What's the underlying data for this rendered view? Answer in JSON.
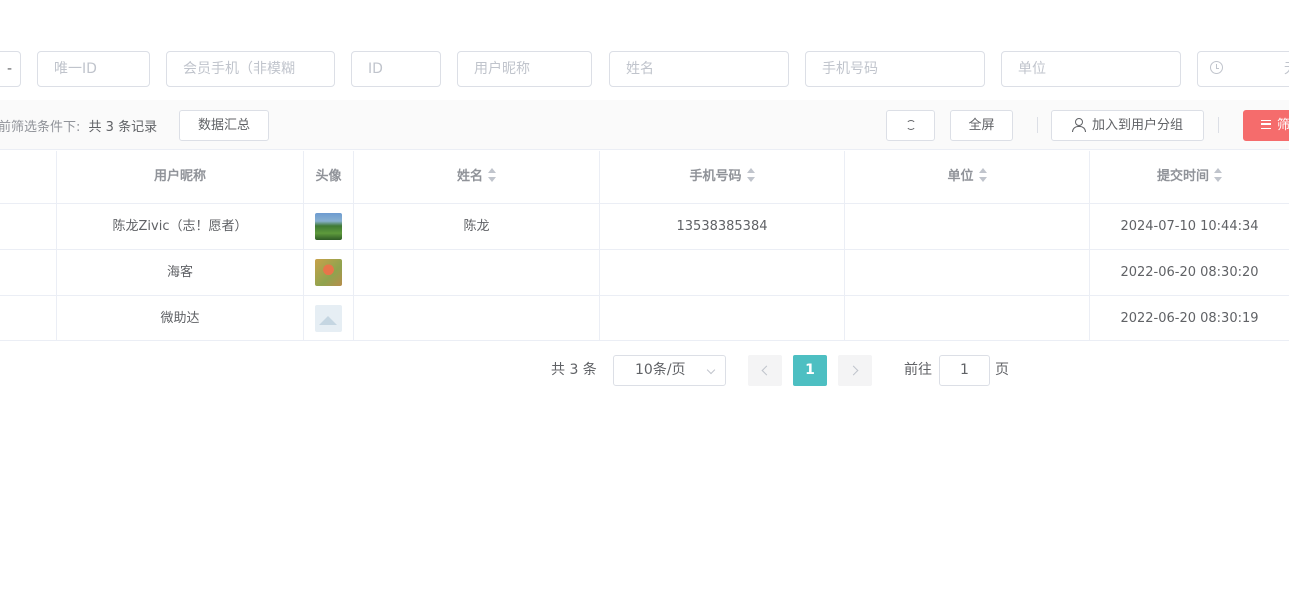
{
  "filters": {
    "stub_label": "-",
    "unique_id_placeholder": "唯一ID",
    "member_phone_placeholder": "会员手机（非模糊",
    "id_placeholder": "ID",
    "nickname_placeholder": "用户昵称",
    "name_placeholder": "姓名",
    "phone_placeholder": "手机号码",
    "unit_placeholder": "单位",
    "date_tail": "无"
  },
  "toolbar": {
    "summary_prefix": "前筛选条件下:",
    "summary_count": "共 3 条记录",
    "data_summary_label": "数据汇总",
    "fullscreen_label": "全屏",
    "add_to_group_label": "加入到用户分组",
    "filter_label": "筛"
  },
  "table": {
    "headers": {
      "nickname": "用户昵称",
      "avatar": "头像",
      "name": "姓名",
      "phone": "手机号码",
      "unit": "单位",
      "submit_time": "提交时间"
    },
    "rows": [
      {
        "nickname": "陈龙Zivic（志！愿者）",
        "avatar": "landscape",
        "name": "陈龙",
        "phone": "13538385384",
        "unit": "",
        "submit_time": "2024-07-10 10:44:34"
      },
      {
        "nickname": "海客",
        "avatar": "person",
        "name": "",
        "phone": "",
        "unit": "",
        "submit_time": "2022-06-20 08:30:20"
      },
      {
        "nickname": "微助达",
        "avatar": "placeholder",
        "name": "",
        "phone": "",
        "unit": "",
        "submit_time": "2022-06-20 08:30:19"
      }
    ]
  },
  "pagination": {
    "total": "共 3 条",
    "page_size": "10条/页",
    "current_page": "1",
    "goto_label": "前往",
    "goto_value": "1",
    "page_unit": "页"
  },
  "colors": {
    "accent": "#4dbfc2",
    "danger": "#f56c6c"
  }
}
